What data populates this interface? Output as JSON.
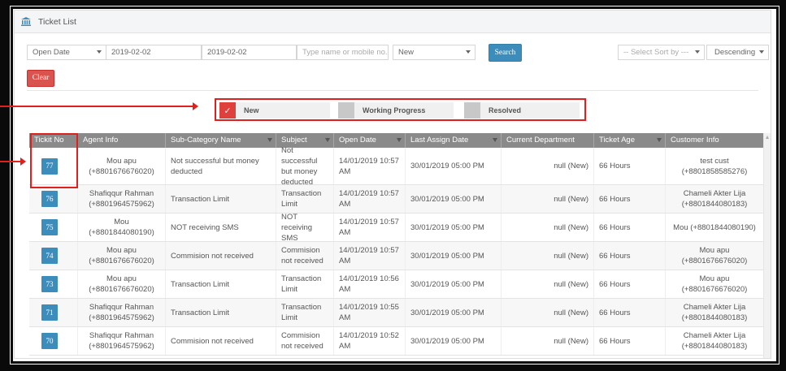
{
  "panel": {
    "title": "Ticket List",
    "icon": "bank-icon"
  },
  "filters": {
    "date_field": "Open Date",
    "from_date": "2019-02-02",
    "to_date": "2019-02-02",
    "search_placeholder": "Type name or mobile no.",
    "status": "New",
    "search_label": "Search",
    "sort_by": "-- Select Sort by ---",
    "sort_order": "Descending",
    "clear_label": "Clear"
  },
  "status_steps": [
    {
      "label": "New",
      "active": true,
      "mark": "✓"
    },
    {
      "label": "Working Progress",
      "active": false
    },
    {
      "label": "Resolved",
      "active": false
    }
  ],
  "table": {
    "headers": [
      "Tickit No",
      "Agent Info",
      "Sub-Category Name",
      "Subject",
      "Open Date",
      "Last Assign Date",
      "Current Department",
      "Ticket Age",
      "Customer Info"
    ],
    "rows": [
      {
        "id": "77",
        "agent": "Mou apu (+8801676676020)",
        "subcat": "Not successful but money deducted",
        "subject": "Not successful but money deducted",
        "open": "14/01/2019 10:57 AM",
        "assign": "30/01/2019 05:00 PM",
        "dept": "null (New)",
        "age": "66 Hours",
        "customer": "test cust (+8801858585276)"
      },
      {
        "id": "76",
        "agent": "Shafiqqur Rahman (+8801964575962)",
        "subcat": "Transaction Limit",
        "subject": "Transaction Limit",
        "open": "14/01/2019 10:57 AM",
        "assign": "30/01/2019 05:00 PM",
        "dept": "null (New)",
        "age": "66 Hours",
        "customer": "Chameli Akter Lija (+8801844080183)"
      },
      {
        "id": "75",
        "agent": "Mou (+8801844080190)",
        "subcat": "NOT receiving SMS",
        "subject": "NOT receiving SMS",
        "open": "14/01/2019 10:57 AM",
        "assign": "30/01/2019 05:00 PM",
        "dept": "null (New)",
        "age": "66 Hours",
        "customer": "Mou (+8801844080190)"
      },
      {
        "id": "74",
        "agent": "Mou apu (+8801676676020)",
        "subcat": "Commision not received",
        "subject": "Commision not received",
        "open": "14/01/2019 10:57 AM",
        "assign": "30/01/2019 05:00 PM",
        "dept": "null (New)",
        "age": "66 Hours",
        "customer": "Mou apu (+8801676676020)"
      },
      {
        "id": "73",
        "agent": "Mou apu (+8801676676020)",
        "subcat": "Transaction Limit",
        "subject": "Transaction Limit",
        "open": "14/01/2019 10:56 AM",
        "assign": "30/01/2019 05:00 PM",
        "dept": "null (New)",
        "age": "66 Hours",
        "customer": "Mou apu (+8801676676020)"
      },
      {
        "id": "71",
        "agent": "Shafiqqur Rahman (+8801964575962)",
        "subcat": "Transaction Limit",
        "subject": "Transaction Limit",
        "open": "14/01/2019 10:55 AM",
        "assign": "30/01/2019 05:00 PM",
        "dept": "null (New)",
        "age": "66 Hours",
        "customer": "Chameli Akter Lija (+8801844080183)"
      },
      {
        "id": "70",
        "agent": "Shafiqqur Rahman (+8801964575962)",
        "subcat": "Commision not received",
        "subject": "Commision not received",
        "open": "14/01/2019 10:52 AM",
        "assign": "30/01/2019 05:00 PM",
        "dept": "null (New)",
        "age": "66 Hours",
        "customer": "Chameli Akter Lija (+8801844080183)"
      }
    ]
  },
  "colors": {
    "accent": "#3c8dbc",
    "danger": "#d9534f",
    "annotation": "#e0201c",
    "header_bg": "#8a8a8a"
  }
}
